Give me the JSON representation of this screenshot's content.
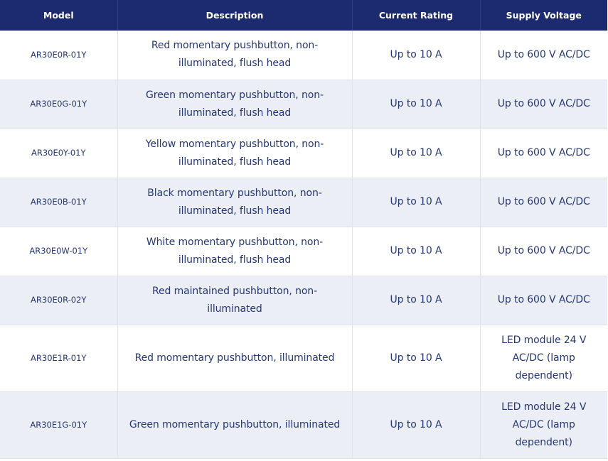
{
  "table": {
    "headers": [
      "Model",
      "Description",
      "Current Rating",
      "Supply Voltage"
    ],
    "rows": [
      {
        "model": "AR30E0R-01Y",
        "description": "Red momentary pushbutton, non-illuminated, flush head",
        "current": "Up to 10 A",
        "voltage": "Up to 600 V AC/DC"
      },
      {
        "model": "AR30E0G-01Y",
        "description": "Green momentary pushbutton, non-illuminated, flush head",
        "current": "Up to 10 A",
        "voltage": "Up to 600 V AC/DC"
      },
      {
        "model": "AR30E0Y-01Y",
        "description": "Yellow momentary pushbutton, non-illuminated, flush head",
        "current": "Up to 10 A",
        "voltage": "Up to 600 V AC/DC"
      },
      {
        "model": "AR30E0B-01Y",
        "description": "Black momentary pushbutton, non-illuminated, flush head",
        "current": "Up to 10 A",
        "voltage": "Up to 600 V AC/DC"
      },
      {
        "model": "AR30E0W-01Y",
        "description": "White momentary pushbutton, non-illuminated, flush head",
        "current": "Up to 10 A",
        "voltage": "Up to 600 V AC/DC"
      },
      {
        "model": "AR30E0R-02Y",
        "description": "Red maintained pushbutton, non-illuminated",
        "current": "Up to 10 A",
        "voltage": "Up to 600 V AC/DC"
      },
      {
        "model": "AR30E1R-01Y",
        "description": "Red momentary pushbutton, illuminated",
        "current": "Up to 10 A",
        "voltage": "LED module 24 V AC/DC (lamp dependent)"
      },
      {
        "model": "AR30E1G-01Y",
        "description": "Green momentary pushbutton, illuminated",
        "current": "Up to 10 A",
        "voltage": "LED module 24 V AC/DC (lamp dependent)"
      }
    ]
  },
  "colors": {
    "header_bg": "#1c2b6f",
    "header_text": "#ffffff",
    "body_text": "#263774",
    "row_shade": "#ebeef5",
    "row_white": "#ffffff"
  }
}
